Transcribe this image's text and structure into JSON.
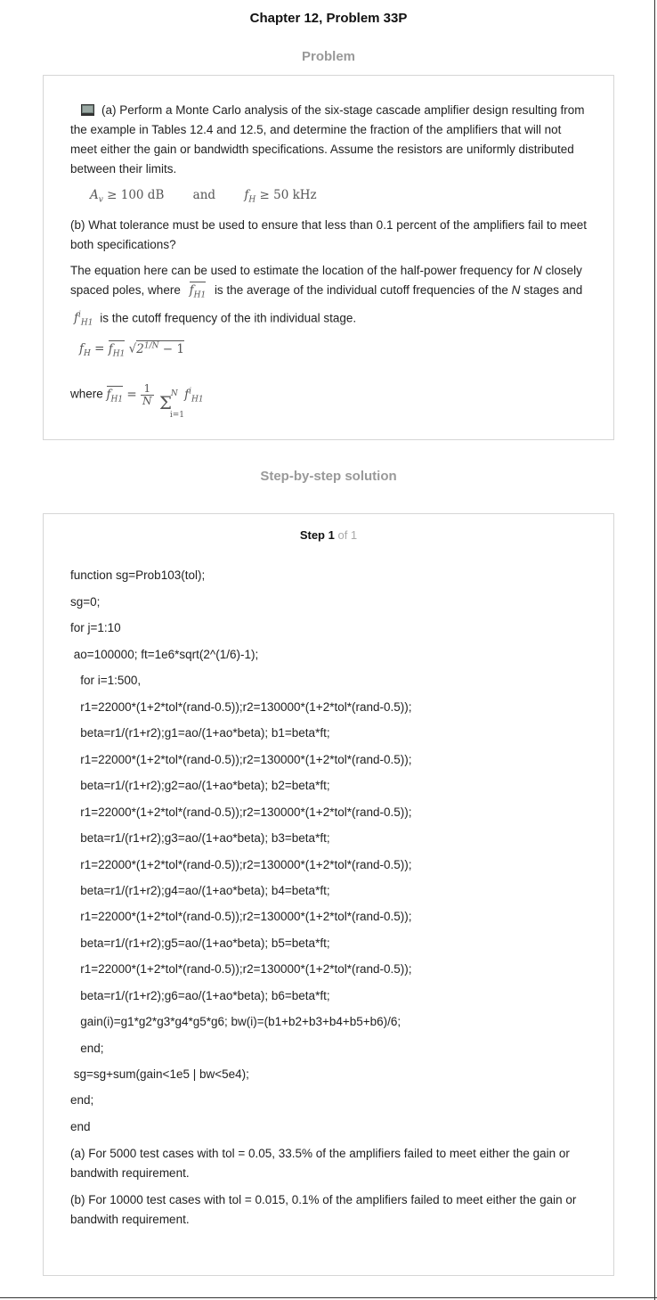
{
  "header": {
    "title": "Chapter 12, Problem 33P"
  },
  "problem": {
    "section_label": "Problem",
    "para_a": "(a) Perform a Monte Carlo analysis of the six-stage cascade amplifier design resulting from the example in Tables 12.4 and 12.5, and determine the fraction of the amplifiers that will not meet either the gain or bandwidth specifications. Assume the resistors are uniformly distributed between their limits.",
    "spec": {
      "gain_rhs": "100 dB",
      "and": "and",
      "bw_rhs": "50 kHz"
    },
    "para_b": "(b) What tolerance must be used to ensure that less than 0.1 percent of the amplifiers fail to meet both specifications?",
    "para_eq": {
      "part1": "The equation here can be used to estimate the location of the half-power frequency for",
      "n1": "N",
      "part2": "closely spaced poles, where",
      "part3": "is the average of the individual cutoff frequencies of the",
      "n2": "N",
      "part4": "stages and",
      "part5": "is the cutoff frequency of the ith individual stage."
    },
    "where_label": "where"
  },
  "solution": {
    "section_label": "Step-by-step solution",
    "step_label": "Step 1",
    "step_of": "of 1",
    "code_lines": [
      "function sg=Prob103(tol);",
      "sg=0;",
      "for j=1:10",
      " ao=100000; ft=1e6*sqrt(2^(1/6)-1);",
      "   for i=1:500,",
      "   r1=22000*(1+2*tol*(rand-0.5));r2=130000*(1+2*tol*(rand-0.5));",
      "   beta=r1/(r1+r2);g1=ao/(1+ao*beta); b1=beta*ft;",
      "   r1=22000*(1+2*tol*(rand-0.5));r2=130000*(1+2*tol*(rand-0.5));",
      "   beta=r1/(r1+r2);g2=ao/(1+ao*beta); b2=beta*ft;",
      "   r1=22000*(1+2*tol*(rand-0.5));r2=130000*(1+2*tol*(rand-0.5));",
      "   beta=r1/(r1+r2);g3=ao/(1+ao*beta); b3=beta*ft;",
      "   r1=22000*(1+2*tol*(rand-0.5));r2=130000*(1+2*tol*(rand-0.5));",
      "   beta=r1/(r1+r2);g4=ao/(1+ao*beta); b4=beta*ft;",
      "   r1=22000*(1+2*tol*(rand-0.5));r2=130000*(1+2*tol*(rand-0.5));",
      "   beta=r1/(r1+r2);g5=ao/(1+ao*beta); b5=beta*ft;",
      "   r1=22000*(1+2*tol*(rand-0.5));r2=130000*(1+2*tol*(rand-0.5));",
      "   beta=r1/(r1+r2);g6=ao/(1+ao*beta); b6=beta*ft;",
      "   gain(i)=g1*g2*g3*g4*g5*g6; bw(i)=(b1+b2+b3+b4+b5+b6)/6;",
      "   end;",
      " sg=sg+sum(gain<1e5 | bw<5e4);",
      "end;",
      "end"
    ],
    "answer_a": "(a) For 5000 test cases with tol = 0.05,  33.5%  of the amplifiers failed to meet either the gain or bandwith requirement.",
    "answer_b": "(b) For 10000 test cases with tol = 0.015,  0.1%  of the amplifiers failed to meet either the gain or bandwith requirement."
  },
  "icons": {
    "textbook": "book-icon"
  }
}
